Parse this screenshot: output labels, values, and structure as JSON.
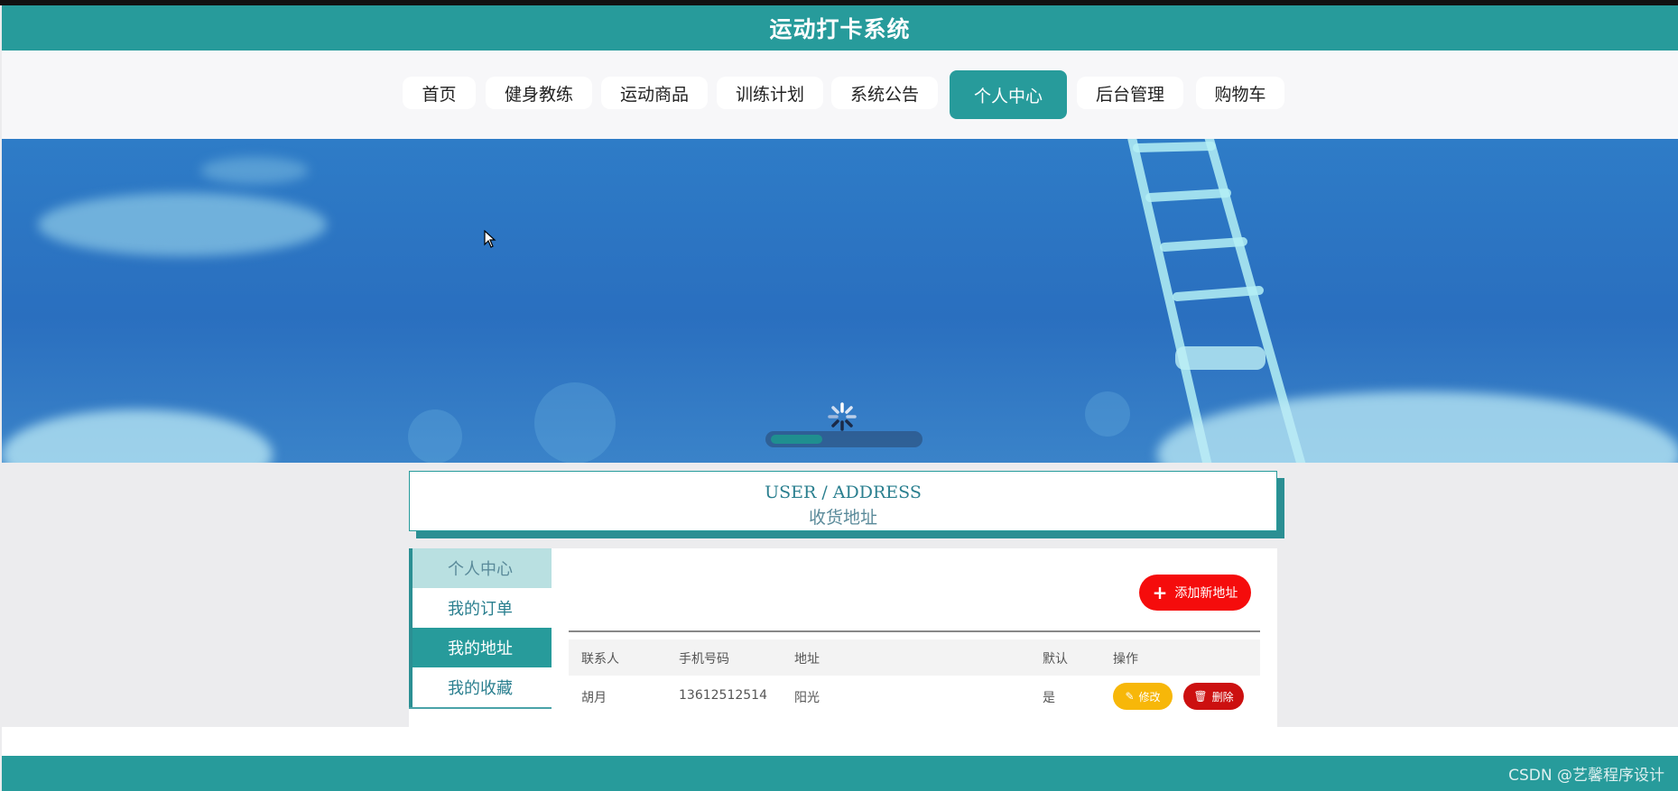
{
  "header": {
    "title": "运动打卡系统"
  },
  "nav": {
    "items": [
      {
        "label": "首页"
      },
      {
        "label": "健身教练"
      },
      {
        "label": "运动商品"
      },
      {
        "label": "训练计划"
      },
      {
        "label": "系统公告"
      },
      {
        "label": "个人中心",
        "active": true
      },
      {
        "label": "后台管理"
      },
      {
        "label": "购物车"
      }
    ]
  },
  "banner": {
    "loading_progress_percent": 35
  },
  "section_title": {
    "en": "USER / ADDRESS",
    "cn": "收货地址"
  },
  "side_menu": {
    "header": "个人中心",
    "items": [
      {
        "label": "我的订单"
      },
      {
        "label": "我的地址",
        "active": true
      },
      {
        "label": "我的收藏"
      }
    ]
  },
  "toolbar": {
    "add_label": "添加新地址"
  },
  "table": {
    "columns": [
      "联系人",
      "手机号码",
      "地址",
      "默认",
      "操作"
    ],
    "rows": [
      {
        "contact": "胡月",
        "phone": "13612512514",
        "address": "阳光",
        "default": "是",
        "edit_label": "修改",
        "delete_label": "删除"
      }
    ]
  },
  "watermark": "CSDN @艺馨程序设计",
  "colors": {
    "primary": "#279b9b",
    "danger": "#f50c0c",
    "warning": "#f7b709",
    "delete": "#cc1010"
  }
}
